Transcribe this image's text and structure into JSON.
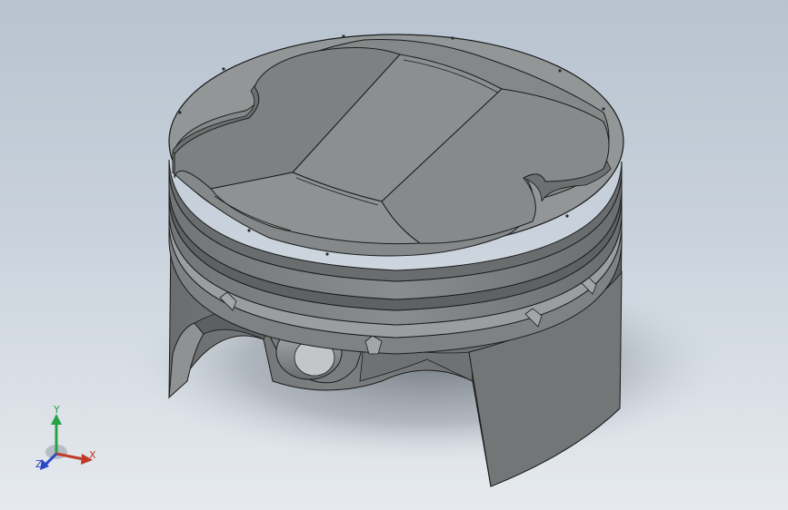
{
  "viewport": {
    "background_top": "#b7c3d0",
    "background_bottom": "#e6eaee"
  },
  "model": {
    "part": "piston",
    "shade_color": "#8a8d8e",
    "edge_color": "#1b1b1b"
  },
  "triad": {
    "x_label": "X",
    "y_label": "Y",
    "z_label": "Z",
    "x_color": "#c0392b",
    "y_color": "#27a347",
    "z_color": "#2c48c4"
  }
}
